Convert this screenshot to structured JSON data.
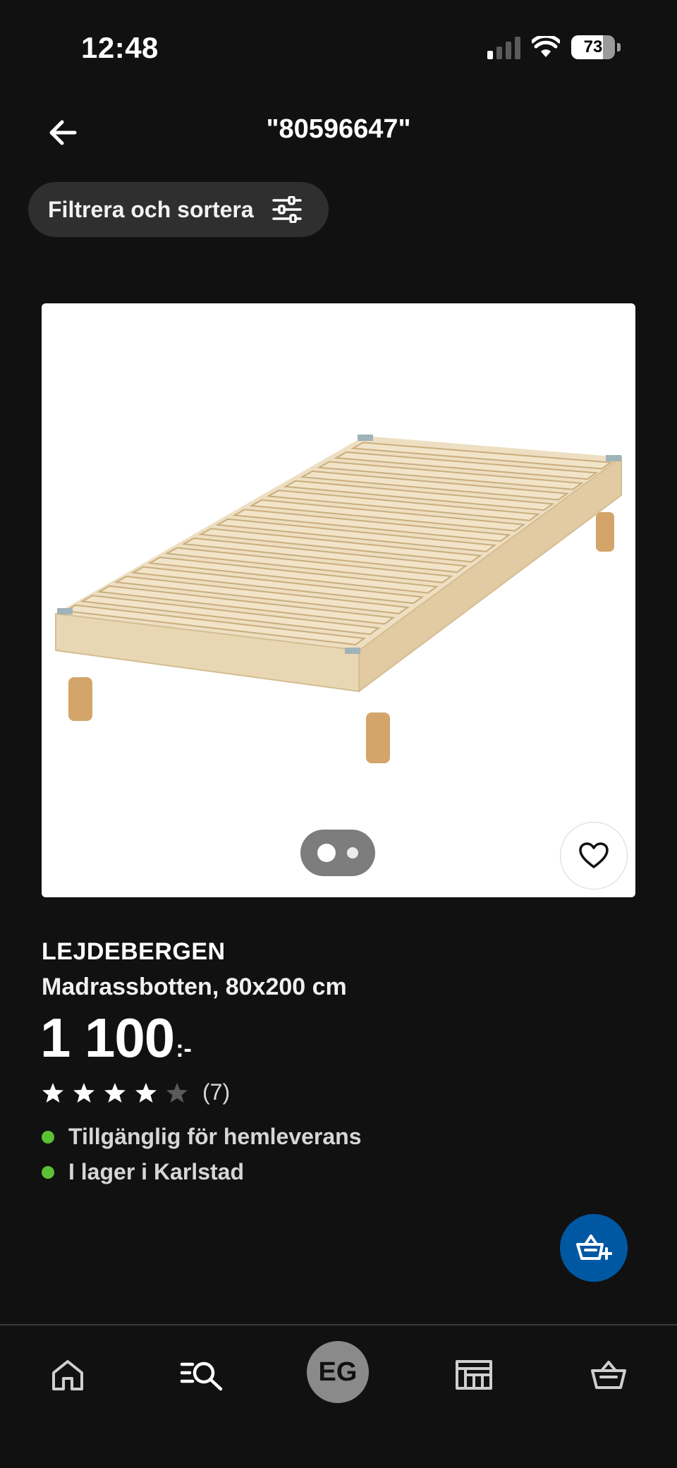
{
  "status_bar": {
    "time": "12:48",
    "battery": "73",
    "battery_level": 0.73,
    "signal_bars_on": 1,
    "signal_bars_total": 4
  },
  "header": {
    "title": "\"80596647\"",
    "back_icon": "arrow-left-icon"
  },
  "filter": {
    "label": "Filtrera och sortera",
    "icon": "sliders-icon"
  },
  "product": {
    "image_icon": "bed-base-photo",
    "carousel_total": 2,
    "carousel_active": 1,
    "favorite_icon": "heart-icon",
    "brand": "LEJDEBERGEN",
    "description": "Madrassbotten, 80x200 cm",
    "price": "1 100",
    "price_suffix": ":-",
    "rating_value": 4,
    "rating_max": 5,
    "review_count": "(7)",
    "availability": [
      {
        "text": "Tillgänglig för hemleverans",
        "status_color": "#5bc236"
      },
      {
        "text": "I lager i Karlstad",
        "status_color": "#5bc236"
      }
    ],
    "add_to_cart_icon": "basket-plus-icon"
  },
  "bottom_nav": {
    "items": [
      {
        "icon": "home-icon"
      },
      {
        "icon": "search-list-icon"
      },
      {
        "avatar_initials": "EG"
      },
      {
        "icon": "store-icon"
      },
      {
        "icon": "basket-icon"
      }
    ]
  },
  "colors": {
    "background": "#111111",
    "accent_blue": "#0058a3",
    "chip_bg": "#2f2f2f",
    "in_stock_green": "#5bc236"
  }
}
